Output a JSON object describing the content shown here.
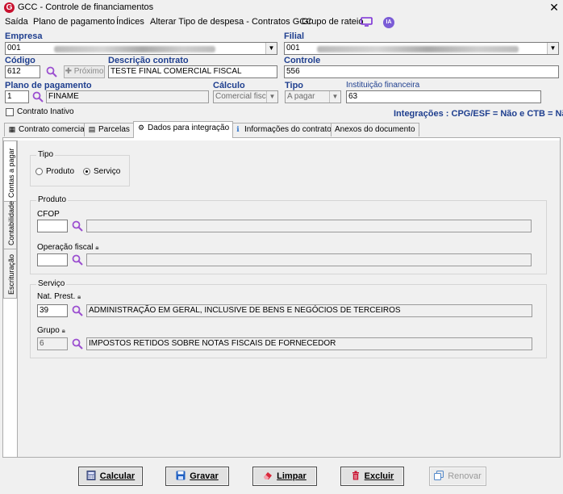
{
  "window": {
    "title": "GCC - Controle de financiamentos"
  },
  "menu": [
    "Saída",
    "Plano de pagamento",
    "Índices",
    "Alterar Tipo de despesa - Contratos GCC",
    "Grupo de rateio"
  ],
  "ia_badge": "IA",
  "labels": {
    "empresa": "Empresa",
    "filial": "Filial",
    "codigo": "Código",
    "descricao": "Descrição contrato",
    "controle": "Controle",
    "plano": "Plano de pagamento",
    "calculo": "Cálculo",
    "tipo": "Tipo",
    "instituicao": "Instituição financeira",
    "inativo": "Contrato Inativo"
  },
  "fields": {
    "empresa_code": "001",
    "filial_code": "001",
    "codigo": "612",
    "proximo": "Próximo",
    "descricao": "TESTE FINAL COMERCIAL FISCAL",
    "controle": "556",
    "plano_code": "1",
    "plano_desc": "FINAME",
    "calculo": "Comercial fiscal",
    "tipo": "A pagar",
    "instituicao": "63"
  },
  "integracoes": "Integrações : CPG/ESF = Não e CTB = Não",
  "tabs": [
    "Contrato comercial",
    "Parcelas",
    "Dados para integração",
    "Informações do contrato",
    "Anexos do documento"
  ],
  "vtabs": [
    "Contas a pagar",
    "Contabilidade",
    "Escrituração"
  ],
  "tipo_group": {
    "title": "Tipo",
    "produto": "Produto",
    "servico": "Serviço"
  },
  "produto_group": {
    "title": "Produto",
    "cfop": "CFOP",
    "operacao": "Operação fiscal"
  },
  "servico_group": {
    "title": "Serviço",
    "nat_label": "Nat. Prest.",
    "nat_code": "39",
    "nat_desc": "ADMINISTRAÇÃO EM GERAL, INCLUSIVE DE BENS E NEGÓCIOS DE TERCEIROS",
    "grupo_label": "Grupo",
    "grupo_code": "6",
    "grupo_desc": "IMPOSTOS RETIDOS SOBRE NOTAS FISCAIS DE FORNECEDOR"
  },
  "buttons": {
    "calcular": "Calcular",
    "gravar": "Gravar",
    "limpar": "Limpar",
    "excluir": "Excluir",
    "renovar": "Renovar"
  },
  "colors": {
    "accent_purple": "#9b4fd0",
    "label_blue": "#1f3f8f",
    "brand_red": "#c8102e"
  }
}
